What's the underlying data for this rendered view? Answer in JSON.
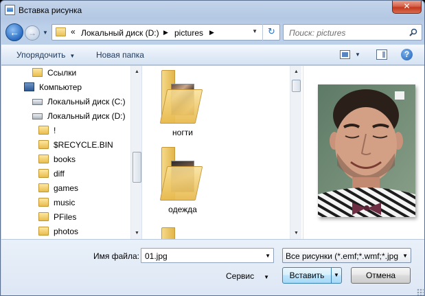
{
  "window": {
    "title": "Вставка рисунка",
    "close_label": "✕"
  },
  "nav": {
    "back_icon": "back-arrow-icon",
    "forward_icon": "forward-arrow-icon",
    "breadcrumb_prefix": "«",
    "breadcrumb": [
      "Локальный диск (D:)",
      "pictures"
    ],
    "search_placeholder": "Поиск: pictures"
  },
  "toolbar": {
    "organize": "Упорядочить",
    "new_folder": "Новая папка"
  },
  "tree": [
    {
      "label": "Ссылки",
      "icon": "links-icon",
      "indent": 1
    },
    {
      "label": "Компьютер",
      "icon": "computer-icon",
      "indent": 0
    },
    {
      "label": "Локальный диск (C:)",
      "icon": "drive-icon",
      "indent": 1
    },
    {
      "label": "Локальный диск (D:)",
      "icon": "drive-icon",
      "indent": 1
    },
    {
      "label": "!",
      "icon": "folder-icon",
      "indent": 2
    },
    {
      "label": "$RECYCLE.BIN",
      "icon": "folder-icon",
      "indent": 2
    },
    {
      "label": "books",
      "icon": "folder-icon",
      "indent": 2
    },
    {
      "label": "diff",
      "icon": "folder-icon",
      "indent": 2
    },
    {
      "label": "games",
      "icon": "folder-icon",
      "indent": 2
    },
    {
      "label": "music",
      "icon": "folder-icon",
      "indent": 2
    },
    {
      "label": "PFiles",
      "icon": "folder-icon",
      "indent": 2
    },
    {
      "label": "photos",
      "icon": "folder-icon",
      "indent": 2
    }
  ],
  "files": [
    {
      "label": "ногти"
    },
    {
      "label": "одежда"
    },
    {
      "label": ""
    }
  ],
  "bottom": {
    "filename_label": "Имя файла:",
    "filename_value": "01.jpg",
    "filter_value": "Все рисунки (*.emf;*.wmf;*.jpg",
    "tools_label": "Сервис",
    "insert_label": "Вставить",
    "cancel_label": "Отмена"
  },
  "colors": {
    "accent": "#2a6bc1",
    "close": "#c2391f",
    "folder": "#e9bd4d"
  }
}
